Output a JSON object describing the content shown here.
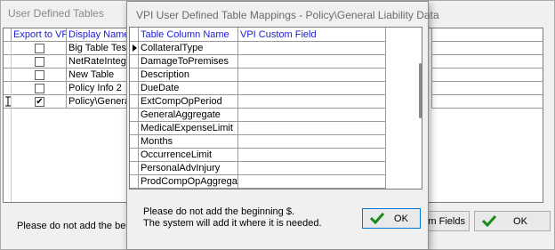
{
  "background_window": {
    "title": "User Defined Tables",
    "columns": {
      "export": "Export to VPI",
      "display_name": "Display Name"
    },
    "rows": [
      {
        "checked": false,
        "name": "Big Table Test"
      },
      {
        "checked": false,
        "name": "NetRateIntegra"
      },
      {
        "checked": false,
        "name": "New Table"
      },
      {
        "checked": false,
        "name": "Policy Info 2"
      },
      {
        "checked": true,
        "name": "Policy\\General Li"
      }
    ],
    "note": "Please do not add the beginn",
    "fields_button": "tom Fields",
    "ok_button": "OK"
  },
  "dialog": {
    "title": "VPI User Defined Table Mappings - Policy\\General Liability Data",
    "columns": {
      "table_column": "Table Column Name",
      "custom_field": "VPI Custom Field"
    },
    "rows": [
      "CollateralType",
      "DamageToPremises",
      "Description",
      "DueDate",
      "ExtCompOpPeriod",
      "GeneralAggregate",
      "MedicalExpenseLimit",
      "Months",
      "OccurrenceLimit",
      "PersonalAdvInjury",
      "ProdCompOpAggregate"
    ],
    "note_line1": "Please do not add the beginning $.",
    "note_line2": "The system will add it where it is needed.",
    "ok_button": "OK"
  },
  "colors": {
    "header_text": "#1c1cd0",
    "ok_check": "#1a8a1a",
    "focus_border": "#0078d7"
  }
}
